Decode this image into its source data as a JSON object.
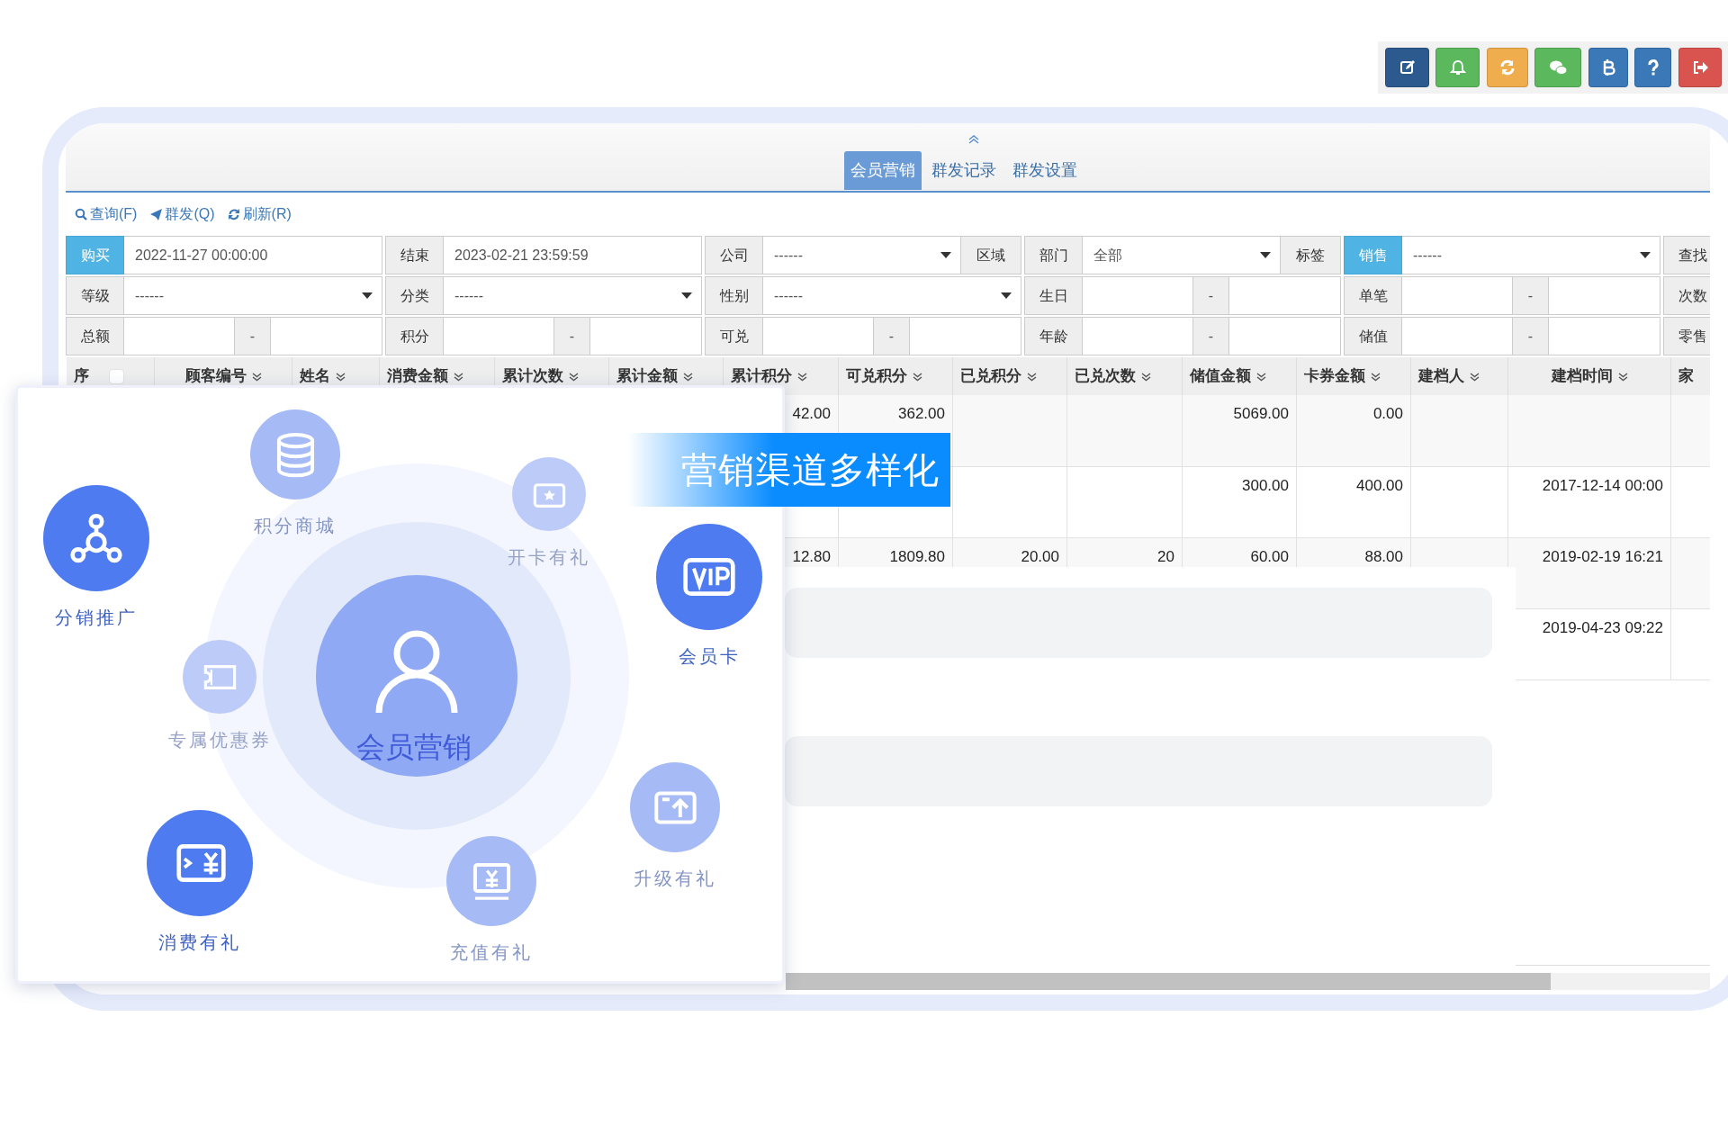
{
  "toolbar_buttons": [
    {
      "kind": "edit",
      "color": "#2d5a8e"
    },
    {
      "kind": "bell",
      "color": "#5cb85c"
    },
    {
      "kind": "refresh",
      "color": "#f0ad4e"
    },
    {
      "kind": "chat",
      "color": "#5cb85c"
    },
    {
      "kind": "coin",
      "color": "#3a78b8"
    },
    {
      "kind": "help",
      "color": "#3a78b8"
    },
    {
      "kind": "logout",
      "color": "#d9534f"
    }
  ],
  "tabs": [
    {
      "label": "会员营销",
      "selected": true
    },
    {
      "label": "群发记录",
      "selected": false
    },
    {
      "label": "群发设置",
      "selected": false
    }
  ],
  "actions": [
    {
      "kind": "search",
      "label": "查询(F)"
    },
    {
      "kind": "send",
      "label": "群发(Q)"
    },
    {
      "kind": "refresh",
      "label": "刷新(R)"
    }
  ],
  "filter_rows": [
    [
      {
        "label": "购买",
        "active": true,
        "kind": "input",
        "value": "2022-11-27 00:00:00"
      },
      {
        "label": "结束",
        "active": false,
        "kind": "input",
        "value": "2023-02-21 23:59:59"
      },
      {
        "label": "公司",
        "active": false,
        "kind": "select",
        "value": "------",
        "suffix": "区域"
      },
      {
        "label": "部门",
        "active": false,
        "kind": "select",
        "value": "全部",
        "suffix": "标签"
      },
      {
        "label": "销售",
        "active": true,
        "kind": "select",
        "value": "------"
      },
      {
        "label": "查找",
        "active": false,
        "kind": "cut"
      }
    ],
    [
      {
        "label": "等级",
        "active": false,
        "kind": "select",
        "value": "------"
      },
      {
        "label": "分类",
        "active": false,
        "kind": "select",
        "value": "------"
      },
      {
        "label": "性别",
        "active": false,
        "kind": "select",
        "value": "------"
      },
      {
        "label": "生日",
        "active": false,
        "kind": "range",
        "dash": "-"
      },
      {
        "label": "单笔",
        "active": false,
        "kind": "range",
        "dash": "-"
      },
      {
        "label": "次数",
        "active": false,
        "kind": "cut"
      }
    ],
    [
      {
        "label": "总额",
        "active": false,
        "kind": "range",
        "dash": "-"
      },
      {
        "label": "积分",
        "active": false,
        "kind": "range",
        "dash": "-"
      },
      {
        "label": "可兑",
        "active": false,
        "kind": "range",
        "dash": "-"
      },
      {
        "label": "年龄",
        "active": false,
        "kind": "range",
        "dash": "-"
      },
      {
        "label": "储值",
        "active": false,
        "kind": "range",
        "dash": "-"
      },
      {
        "label": "零售",
        "active": false,
        "kind": "cut"
      }
    ]
  ],
  "table": {
    "columns": [
      {
        "label": "序",
        "kind": "check",
        "checked": false
      },
      {
        "label": "顾客编号",
        "kind": "sort"
      },
      {
        "label": "姓名",
        "kind": "sort"
      },
      {
        "label": "消费金额",
        "kind": "sort"
      },
      {
        "label": "累计次数",
        "kind": "sort"
      },
      {
        "label": "累计金额",
        "kind": "sort"
      },
      {
        "label": "累计积分",
        "kind": "sort"
      },
      {
        "label": "可兑积分",
        "kind": "sort"
      },
      {
        "label": "已兑积分",
        "kind": "sort"
      },
      {
        "label": "已兑次数",
        "kind": "sort"
      },
      {
        "label": "储值金额",
        "kind": "sort"
      },
      {
        "label": "卡券金额",
        "kind": "sort"
      },
      {
        "label": "建档人",
        "kind": "sort"
      },
      {
        "label": "建档时间",
        "kind": "sort"
      },
      {
        "label": "家",
        "kind": "plain"
      }
    ],
    "rows": [
      [
        null,
        null,
        null,
        null,
        null,
        null,
        "42.00",
        "362.00",
        null,
        null,
        "5069.00",
        "0.00",
        null,
        null,
        null
      ],
      [
        null,
        null,
        null,
        null,
        null,
        null,
        null,
        null,
        null,
        null,
        "300.00",
        "400.00",
        null,
        "2017-12-14 00:00",
        null
      ],
      [
        null,
        null,
        null,
        null,
        null,
        null,
        "12.80",
        "1809.80",
        "20.00",
        "20",
        "60.00",
        "88.00",
        null,
        "2019-02-19 16:21",
        null
      ],
      [
        null,
        null,
        null,
        null,
        null,
        null,
        null,
        null,
        null,
        null,
        null,
        null,
        null,
        "2019-04-23 09:22",
        null
      ]
    ]
  },
  "promo": {
    "banner": "营销渠道多样化",
    "center": "会员营销",
    "channels": [
      {
        "label": "积分商城",
        "kind": "database",
        "color": "#a6bbf6"
      },
      {
        "label": "开卡有礼",
        "kind": "card",
        "color": "#bccbf8"
      },
      {
        "label": "分销推广",
        "kind": "share",
        "color": "#4e7bf0"
      },
      {
        "label": "会员卡",
        "kind": "vip",
        "color": "#4e7bf0"
      },
      {
        "label": "专属优惠券",
        "kind": "coupon",
        "color": "#bccbf8"
      },
      {
        "label": "消费有礼",
        "kind": "pay",
        "color": "#4e7bf0"
      },
      {
        "label": "充值有礼",
        "kind": "recharge",
        "color": "#a6bbf6"
      },
      {
        "label": "升级有礼",
        "kind": "upgrade",
        "color": "#a6bbf6"
      }
    ]
  }
}
